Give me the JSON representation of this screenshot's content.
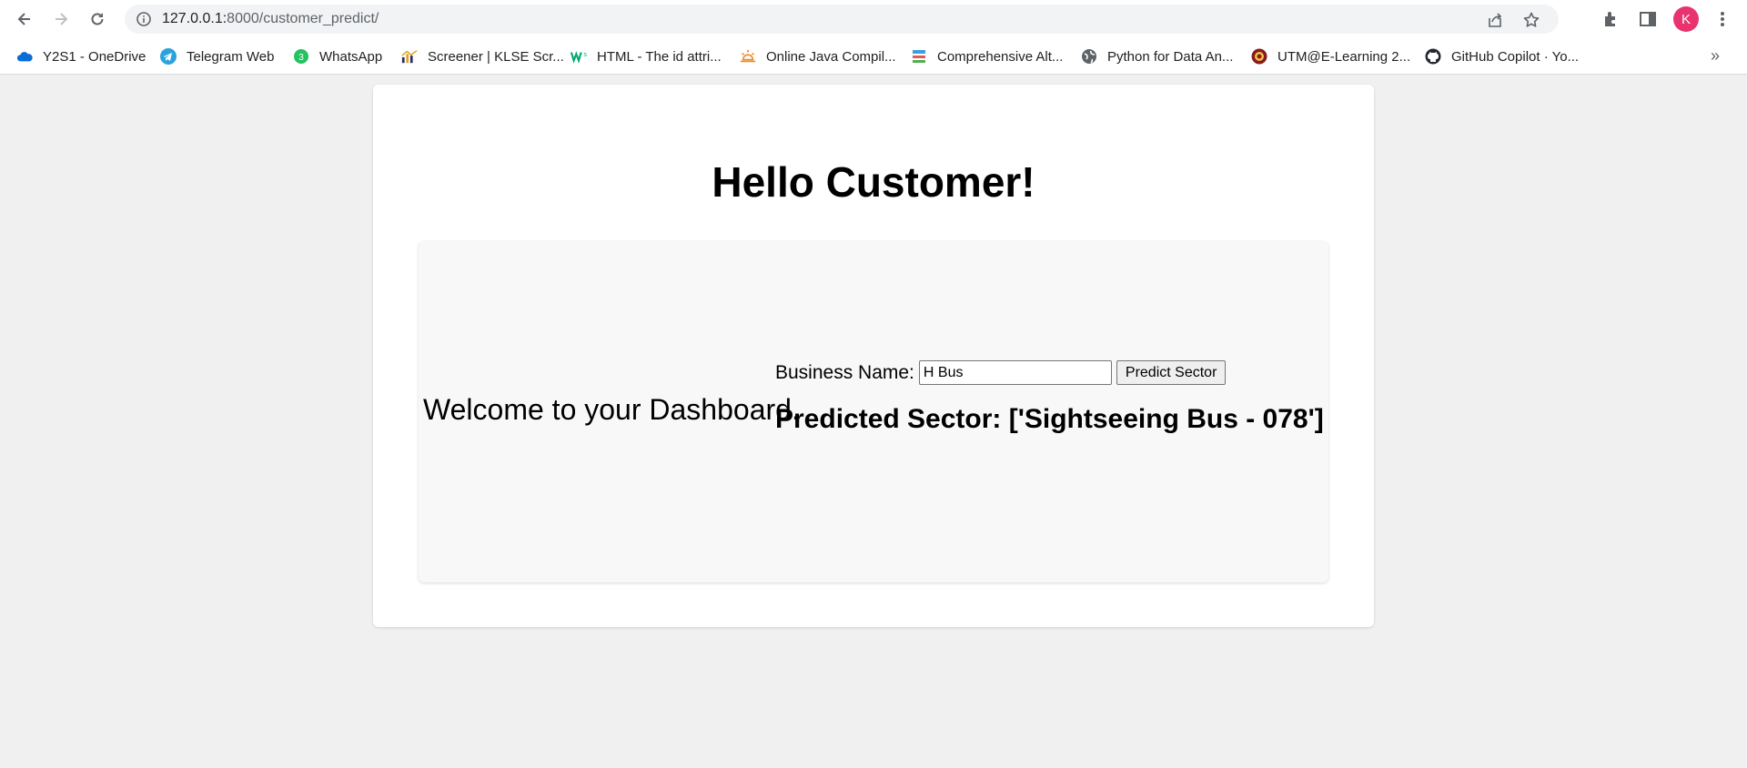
{
  "browser": {
    "url_host": "127.0.0.1:",
    "url_rest": "8000/customer_predict/",
    "profile_initial": "K",
    "bookmarks": [
      {
        "label": "Y2S1 - OneDrive",
        "icon": "onedrive-icon"
      },
      {
        "label": "Telegram Web",
        "icon": "telegram-icon"
      },
      {
        "label": "WhatsApp",
        "icon": "whatsapp-icon"
      },
      {
        "label": "Screener | KLSE Scr...",
        "icon": "screener-icon"
      },
      {
        "label": "HTML - The id attri...",
        "icon": "w3schools-icon"
      },
      {
        "label": "Online Java Compil...",
        "icon": "java-compiler-icon"
      },
      {
        "label": "Comprehensive Alt...",
        "icon": "page-icon"
      },
      {
        "label": "Python for Data An...",
        "icon": "globe-icon"
      },
      {
        "label": "UTM@E-Learning 2...",
        "icon": "utm-icon"
      },
      {
        "label": "GitHub Copilot · Yo...",
        "icon": "github-icon"
      }
    ],
    "more_bookmarks": "»"
  },
  "page": {
    "title": "Hello Customer!",
    "welcome": "Welcome to your Dashboard.",
    "form": {
      "label": "Business Name:",
      "input_value": "H Bus",
      "button_label": "Predict Sector"
    },
    "result": "Predicted Sector: ['Sightseeing Bus - 078']"
  },
  "colors": {
    "page_bg": "#f0f0f0",
    "card_bg": "#ffffff",
    "panel_bg": "#f8f8f8",
    "avatar": "#e8336f"
  }
}
